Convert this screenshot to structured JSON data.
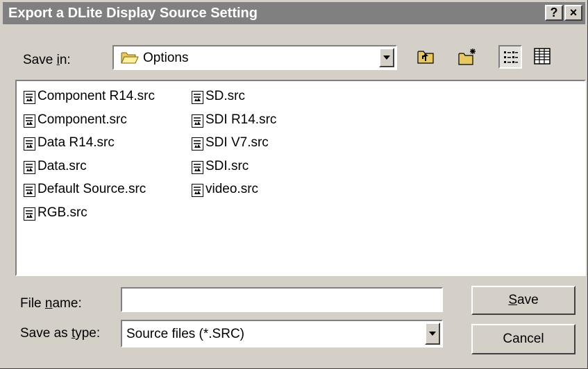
{
  "window": {
    "title": "Export a DLite Display Source Setting",
    "help_button": "?",
    "close_button": "×"
  },
  "save_in": {
    "label_pre": "Save ",
    "label_accel": "i",
    "label_post": "n:",
    "value": "Options"
  },
  "toolbar": {
    "up_folder": "up-one-level-icon",
    "new_folder": "new-folder-icon",
    "list_view": "list-view-icon",
    "details_view": "details-view-icon"
  },
  "files": {
    "column1": [
      "Component R14.src",
      "Component.src",
      "Data R14.src",
      "Data.src",
      "Default Source.src",
      "RGB.src"
    ],
    "column2": [
      "SD.src",
      "SDI R14.src",
      "SDI V7.src",
      "SDI.src",
      "video.src"
    ]
  },
  "file_name": {
    "label_pre": "File ",
    "label_accel": "n",
    "label_post": "ame:",
    "value": ""
  },
  "save_as_type": {
    "label_pre": "Save as ",
    "label_accel": "t",
    "label_post": "ype:",
    "value": "Source files (*.SRC)"
  },
  "buttons": {
    "save_accel": "S",
    "save_rest": "ave",
    "cancel": "Cancel"
  }
}
